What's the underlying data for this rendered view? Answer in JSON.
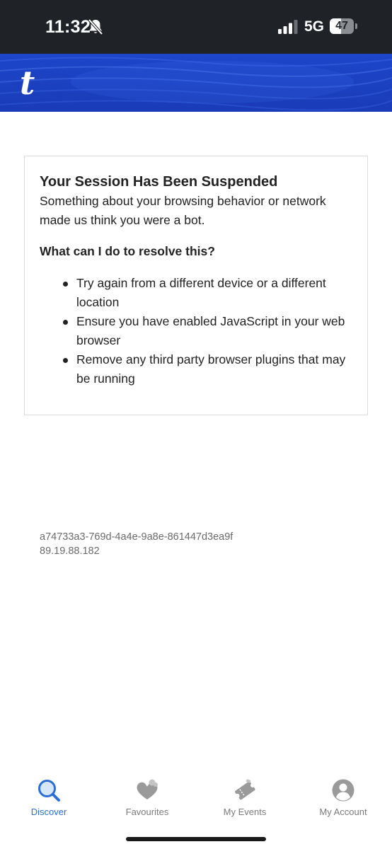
{
  "status_bar": {
    "time": "11:32",
    "network": "5G",
    "battery": "47",
    "battery_level": 0.47,
    "icons": [
      "bell-slash-icon",
      "signal-icon",
      "battery-icon"
    ]
  },
  "header": {
    "logo": "t",
    "brand_color": "#1d46c9"
  },
  "block": {
    "title": "Your Session Has Been Suspended",
    "message": "Something about your browsing behavior or network made us think you were a bot.",
    "resolve_heading": "What can I do to resolve this?",
    "resolve_items": [
      "Try again from a different device or a different location",
      "Ensure you have enabled JavaScript in your web browser",
      "Remove any third party browser plugins that may be running"
    ],
    "reference_id": "a74733a3-769d-4a4e-9a8e-861447d3ea9f",
    "ip_address": "89.19.88.182"
  },
  "bottom_nav": {
    "items": [
      {
        "label": "Discover",
        "icon": "search-icon",
        "active": true
      },
      {
        "label": "Favourites",
        "icon": "heart-icon",
        "active": false
      },
      {
        "label": "My Events",
        "icon": "ticket-icon",
        "active": false
      },
      {
        "label": "My Account",
        "icon": "account-icon",
        "active": false
      }
    ],
    "active_color": "#2a6fd6",
    "inactive_color": "#7a7a7a"
  }
}
